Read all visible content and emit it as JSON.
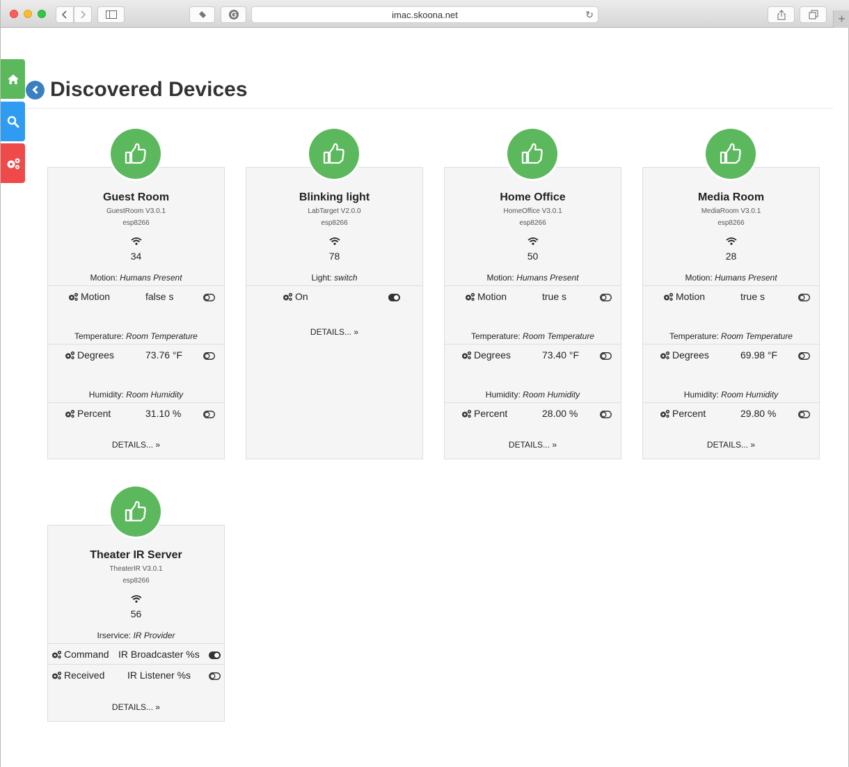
{
  "browser": {
    "url": "imac.skoona.net"
  },
  "page": {
    "title": "Discovered Devices",
    "details_label": "DETAILS... »"
  },
  "devices": [
    {
      "name": "Guest Room",
      "version": "GuestRoom V3.0.1",
      "chip": "esp8266",
      "rssi": "34",
      "sections": [
        {
          "type": "Motion:",
          "desc": "Humans Present",
          "rows": [
            {
              "label": "Motion",
              "value": "false s",
              "on": false
            }
          ]
        },
        {
          "type": "Temperature:",
          "desc": "Room Temperature",
          "rows": [
            {
              "label": "Degrees",
              "value": "73.76 °F",
              "on": false
            }
          ]
        },
        {
          "type": "Humidity:",
          "desc": "Room Humidity",
          "rows": [
            {
              "label": "Percent",
              "value": "31.10 %",
              "on": false
            }
          ]
        }
      ]
    },
    {
      "name": "Blinking light",
      "version": "LabTarget V2.0.0",
      "chip": "esp8266",
      "rssi": "78",
      "sections": [
        {
          "type": "Light:",
          "desc": "switch",
          "rows": [
            {
              "label": "On",
              "value": "",
              "on": true
            }
          ]
        }
      ]
    },
    {
      "name": "Home Office",
      "version": "HomeOffice V3.0.1",
      "chip": "esp8266",
      "rssi": "50",
      "sections": [
        {
          "type": "Motion:",
          "desc": "Humans Present",
          "rows": [
            {
              "label": "Motion",
              "value": "true s",
              "on": false
            }
          ]
        },
        {
          "type": "Temperature:",
          "desc": "Room Temperature",
          "rows": [
            {
              "label": "Degrees",
              "value": "73.40 °F",
              "on": false
            }
          ]
        },
        {
          "type": "Humidity:",
          "desc": "Room Humidity",
          "rows": [
            {
              "label": "Percent",
              "value": "28.00 %",
              "on": false
            }
          ]
        }
      ]
    },
    {
      "name": "Media Room",
      "version": "MediaRoom V3.0.1",
      "chip": "esp8266",
      "rssi": "28",
      "sections": [
        {
          "type": "Motion:",
          "desc": "Humans Present",
          "rows": [
            {
              "label": "Motion",
              "value": "true s",
              "on": false
            }
          ]
        },
        {
          "type": "Temperature:",
          "desc": "Room Temperature",
          "rows": [
            {
              "label": "Degrees",
              "value": "69.98 °F",
              "on": false
            }
          ]
        },
        {
          "type": "Humidity:",
          "desc": "Room Humidity",
          "rows": [
            {
              "label": "Percent",
              "value": "29.80 %",
              "on": false
            }
          ]
        }
      ]
    },
    {
      "name": "Theater IR Server",
      "version": "TheaterIR V3.0.1",
      "chip": "esp8266",
      "rssi": "56",
      "sections": [
        {
          "type": "Irservice:",
          "desc": "IR Provider",
          "rows": [
            {
              "label": "Command",
              "value": "IR Broadcaster %s",
              "on": true
            },
            {
              "label": "Received",
              "value": "IR Listener %s",
              "on": false
            }
          ]
        }
      ]
    }
  ],
  "icons": {
    "badge": "thumbs-up-icon",
    "signal": "wifi-icon",
    "property": "gears-icon",
    "toggle": "toggle-icon",
    "sidebar": [
      "home-icon",
      "search-icon",
      "gears-icon"
    ]
  },
  "colors": {
    "success": "#5cb85c",
    "home_tab": "#5cb85c",
    "search_tab": "#2f9bf1",
    "settings_tab": "#ee4a4a",
    "back": "#3a7fc1"
  }
}
